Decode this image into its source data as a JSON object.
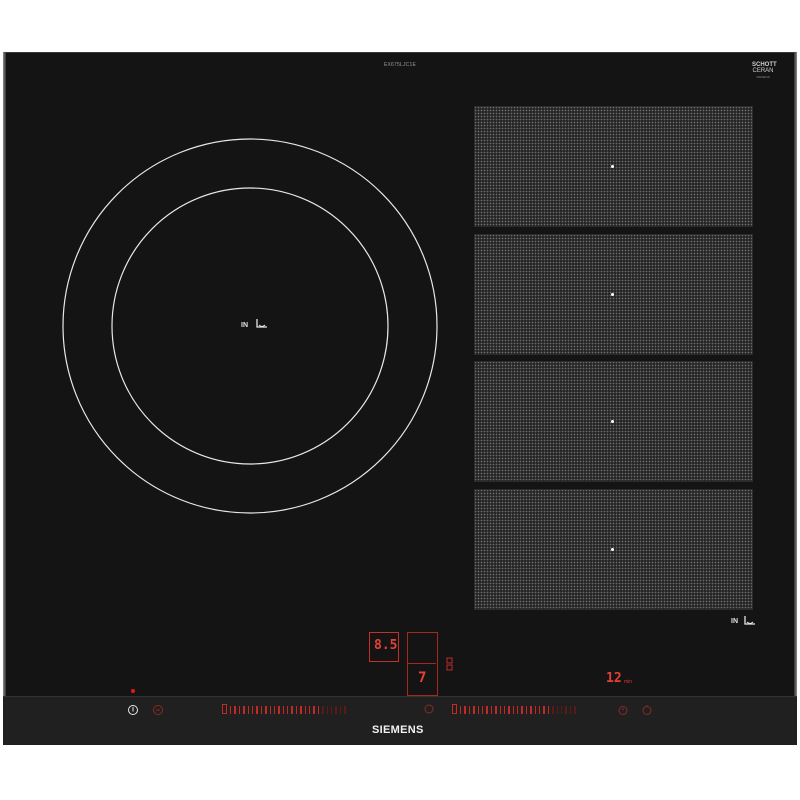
{
  "hob": {
    "model_number": "EX675LJC1E",
    "certification": [
      "SCHOTT",
      "CERAN",
      "SIEMENS"
    ],
    "brand": "SIEMENS"
  },
  "left_zone": {
    "label": "IN"
  },
  "right_zones": {
    "label": "IN",
    "count": 4
  },
  "controls": {
    "power_indicator_color": "#e01a1a",
    "display_left": "8.5",
    "display_center": "7",
    "timer_value": "12",
    "timer_unit": "min"
  },
  "icons": [
    "power-icon",
    "lock-icon",
    "flex-zone-icon",
    "boost-icon",
    "timer-icon",
    "stopwatch-icon",
    "pan-detect-icon"
  ]
}
